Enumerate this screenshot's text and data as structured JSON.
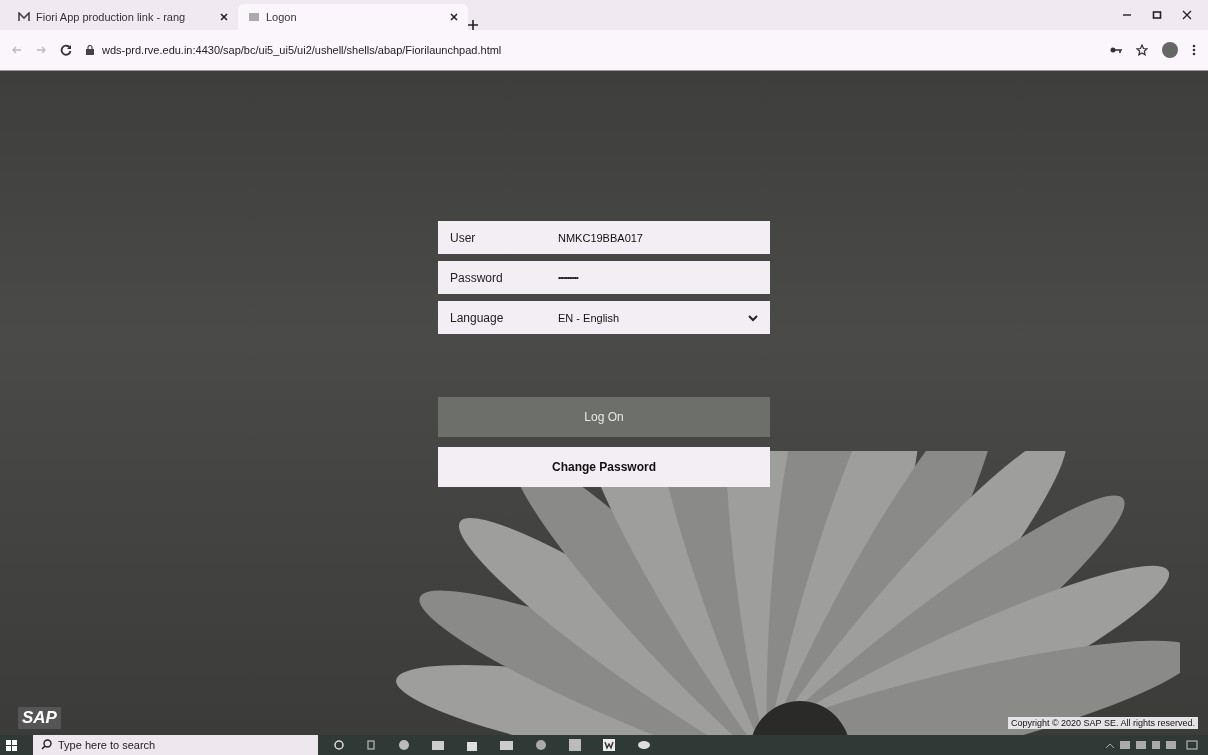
{
  "browser": {
    "tabs": [
      {
        "title": "Fiori App production link - rang",
        "selected": false
      },
      {
        "title": "Logon",
        "selected": true
      }
    ],
    "url": "wds-prd.rve.edu.in:4430/sap/bc/ui5_ui5/ui2/ushell/shells/abap/Fiorilaunchpad.html"
  },
  "login": {
    "fields": [
      {
        "label": "User",
        "value": "NMKC19BBA017",
        "kind": "text"
      },
      {
        "label": "Password",
        "value": "•••••••••••",
        "kind": "password"
      },
      {
        "label": "Language",
        "value": "EN - English",
        "kind": "select"
      }
    ],
    "buttons": [
      {
        "label": "Log On",
        "kind": "primary"
      },
      {
        "label": "Change Password",
        "kind": "secondary"
      }
    ]
  },
  "footer": {
    "logo": "SAP",
    "copyright": "Copyright © 2020 SAP SE. All rights reserved."
  },
  "taskbar": {
    "search": {
      "placeholder": "Type here to search"
    }
  }
}
